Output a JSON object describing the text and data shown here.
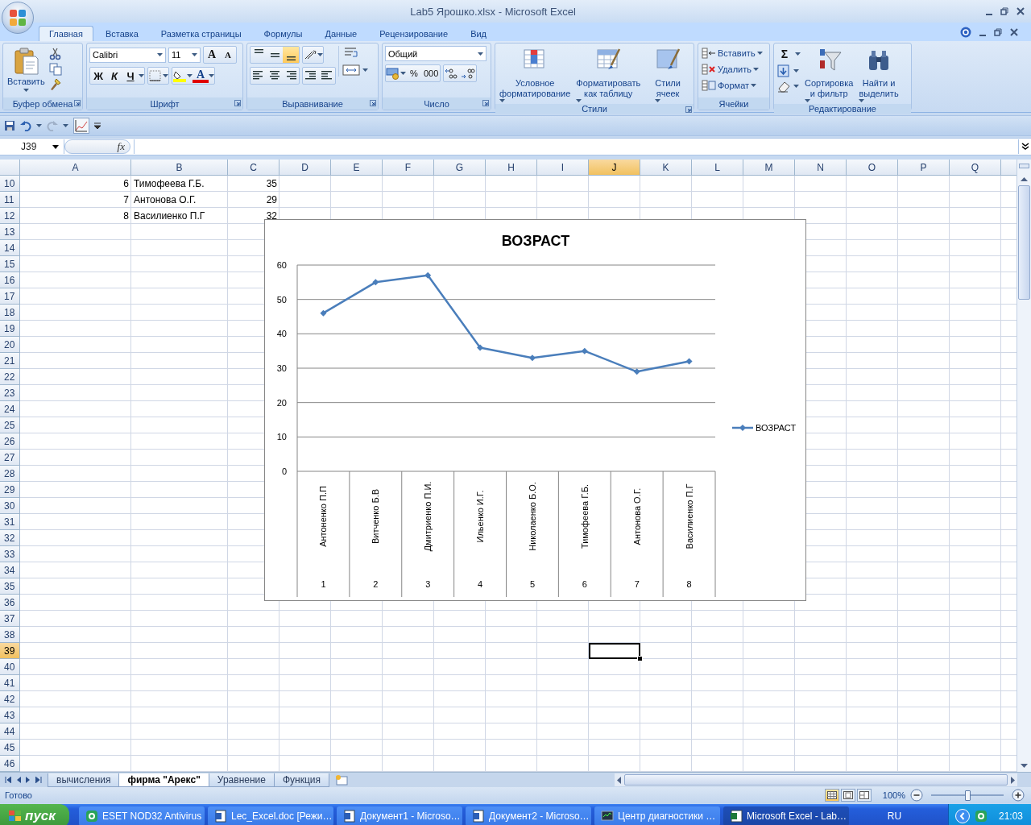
{
  "window": {
    "title": "Lab5 Ярошко.xlsx - Microsoft Excel"
  },
  "ribbon": {
    "tabs": [
      {
        "label": "Главная",
        "selected": true
      },
      {
        "label": "Вставка",
        "selected": false
      },
      {
        "label": "Разметка страницы",
        "selected": false
      },
      {
        "label": "Формулы",
        "selected": false
      },
      {
        "label": "Данные",
        "selected": false
      },
      {
        "label": "Рецензирование",
        "selected": false
      },
      {
        "label": "Вид",
        "selected": false
      }
    ],
    "groups": [
      {
        "label": "Буфер обмена",
        "paste": "Вставить"
      },
      {
        "label": "Шрифт",
        "font": "Calibri",
        "size": "11",
        "size_buttons": [
          "A",
          "A"
        ],
        "style_buttons": [
          "Ж",
          "К",
          "Ч"
        ],
        "font_color": "A"
      },
      {
        "label": "Выравнивание",
        "align_buttons": [
          {
            "selected": false
          },
          {
            "selected": false
          },
          {
            "selected": true
          }
        ]
      },
      {
        "label": "Число",
        "format": "Общий",
        "buttons": [
          "%",
          "000"
        ]
      },
      {
        "label": "Стили",
        "buttons": [
          {
            "lines": [
              "Условное",
              "форматирование"
            ]
          },
          {
            "lines": [
              "Форматировать",
              "как таблицу"
            ]
          },
          {
            "lines": [
              "Стили",
              "ячеек"
            ]
          }
        ]
      },
      {
        "label": "Ячейки",
        "buttons": [
          "Вставить",
          "Удалить",
          "Формат"
        ]
      },
      {
        "label": "Редактирование",
        "sum": "Σ",
        "buttons": [
          {
            "lines": [
              "Сортировка",
              "и фильтр"
            ]
          },
          {
            "lines": [
              "Найти и",
              "выделить"
            ]
          }
        ]
      }
    ]
  },
  "formula_bar": {
    "name_box": "J39",
    "fx": "fx"
  },
  "sheet": {
    "columns": [
      {
        "label": "A",
        "selected": false
      },
      {
        "label": "B",
        "selected": false
      },
      {
        "label": "C",
        "selected": false
      },
      {
        "label": "D",
        "selected": false
      },
      {
        "label": "E",
        "selected": false
      },
      {
        "label": "F",
        "selected": false
      },
      {
        "label": "G",
        "selected": false
      },
      {
        "label": "H",
        "selected": false
      },
      {
        "label": "I",
        "selected": false
      },
      {
        "label": "J",
        "selected": true
      },
      {
        "label": "K",
        "selected": false
      },
      {
        "label": "L",
        "selected": false
      },
      {
        "label": "M",
        "selected": false
      },
      {
        "label": "N",
        "selected": false
      },
      {
        "label": "O",
        "selected": false
      },
      {
        "label": "P",
        "selected": false
      },
      {
        "label": "Q",
        "selected": false
      }
    ],
    "rows": [
      {
        "label": "10",
        "selected": false,
        "cells": [
          {
            "text": "6",
            "kind": "number"
          },
          {
            "text": "Тимофеева Г.Б.",
            "kind": "text"
          },
          {
            "text": "35",
            "kind": "number"
          }
        ]
      },
      {
        "label": "11",
        "selected": false,
        "cells": [
          {
            "text": "7",
            "kind": "number"
          },
          {
            "text": "Антонова О.Г.",
            "kind": "text"
          },
          {
            "text": "29",
            "kind": "number"
          }
        ]
      },
      {
        "label": "12",
        "selected": false,
        "cells": [
          {
            "text": "8",
            "kind": "number"
          },
          {
            "text": "Василиенко П.Г",
            "kind": "text"
          },
          {
            "text": "32",
            "kind": "number"
          }
        ]
      },
      {
        "label": "13",
        "selected": false
      },
      {
        "label": "14",
        "selected": false
      },
      {
        "label": "15",
        "selected": false
      },
      {
        "label": "16",
        "selected": false
      },
      {
        "label": "17",
        "selected": false
      },
      {
        "label": "18",
        "selected": false
      },
      {
        "label": "19",
        "selected": false
      },
      {
        "label": "20",
        "selected": false
      },
      {
        "label": "21",
        "selected": false
      },
      {
        "label": "22",
        "selected": false
      },
      {
        "label": "23",
        "selected": false
      },
      {
        "label": "24",
        "selected": false
      },
      {
        "label": "25",
        "selected": false
      },
      {
        "label": "26",
        "selected": false
      },
      {
        "label": "27",
        "selected": false
      },
      {
        "label": "28",
        "selected": false
      },
      {
        "label": "29",
        "selected": false
      },
      {
        "label": "30",
        "selected": false
      },
      {
        "label": "31",
        "selected": false
      },
      {
        "label": "32",
        "selected": false
      },
      {
        "label": "33",
        "selected": false
      },
      {
        "label": "34",
        "selected": false
      },
      {
        "label": "35",
        "selected": false
      },
      {
        "label": "36",
        "selected": false
      },
      {
        "label": "37",
        "selected": false
      },
      {
        "label": "38",
        "selected": false
      },
      {
        "label": "39",
        "selected": true
      },
      {
        "label": "40",
        "selected": false
      },
      {
        "label": "41",
        "selected": false
      },
      {
        "label": "42",
        "selected": false
      },
      {
        "label": "43",
        "selected": false
      },
      {
        "label": "44",
        "selected": false
      },
      {
        "label": "45",
        "selected": false
      },
      {
        "label": "46",
        "selected": false
      }
    ]
  },
  "chart": {
    "axis_numbers": [
      "1",
      "2",
      "3",
      "4",
      "5",
      "6",
      "7",
      "8"
    ],
    "chart_data": {
      "type": "line",
      "title": "ВОЗРАСТ",
      "categories": [
        "Антоненко П.П",
        "Витченко Б.В",
        "Дмитриенко П.И.",
        "Ильенко И.Г.",
        "Николаенко Б.О.",
        "Тимофеева Г.Б.",
        "Антонова О.Г.",
        "Василиенко П.Г"
      ],
      "series": [
        {
          "name": "ВОЗРАСТ",
          "color": "#4a7ebb",
          "marker": "diamond",
          "values": [
            46,
            55,
            57,
            36,
            33,
            35,
            29,
            32
          ]
        }
      ],
      "grid": true,
      "ylim": [
        0,
        60
      ],
      "yticks": [
        0,
        10,
        20,
        30,
        40,
        50,
        60
      ]
    }
  },
  "sheet_tabs": [
    {
      "label": "вычисления",
      "selected": false
    },
    {
      "label": "фирма \"Арекс\"",
      "selected": true
    },
    {
      "label": "Уравнение",
      "selected": false
    },
    {
      "label": "Функция",
      "selected": false
    }
  ],
  "status_bar": {
    "text": "Готово",
    "views": [
      {
        "selected": true
      },
      {
        "selected": false
      },
      {
        "selected": false
      }
    ],
    "zoom": "100%",
    "zoom_slider": {
      "level": 0.5
    }
  },
  "taskbar": {
    "start": "пуск",
    "tasks": [
      {
        "label": "ESET NOD32 Antivirus",
        "kind": "antivirus",
        "selected": false
      },
      {
        "label": "Lec_Excel.doc [Режи…",
        "kind": "document",
        "selected": false
      },
      {
        "label": "Документ1 - Microso…",
        "kind": "document",
        "selected": false
      },
      {
        "label": "Документ2 - Microso…",
        "kind": "document",
        "selected": false
      },
      {
        "label": "Центр диагностики …",
        "kind": "monitor",
        "selected": false
      },
      {
        "label": "Microsoft Excel - Lab…",
        "kind": "spreadsheet",
        "selected": true
      }
    ],
    "language": "RU",
    "clock": "21:03"
  }
}
